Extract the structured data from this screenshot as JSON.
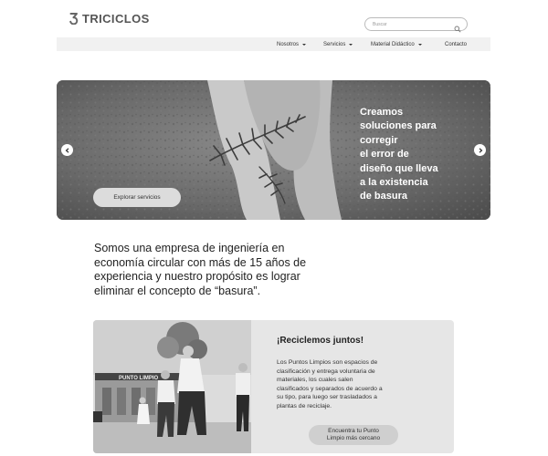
{
  "brand": {
    "name": "TRICICLOS"
  },
  "search": {
    "placeholder": "Buscar"
  },
  "nav": {
    "items": [
      {
        "label": "Nosotros",
        "has_dropdown": true
      },
      {
        "label": "Servicios",
        "has_dropdown": true
      },
      {
        "label": "Material Didáctico",
        "has_dropdown": true
      },
      {
        "label": "Contacto",
        "has_dropdown": false
      }
    ]
  },
  "hero": {
    "lines": [
      "Creamos",
      "soluciones para",
      "corregir",
      "el error de",
      "diseño que lleva",
      "a la existencia",
      "de basura"
    ],
    "button_label": "Explorar servicios"
  },
  "intro": {
    "lines": [
      "Somos una empresa de ingeniería en",
      "economía circular con más de 15 años de",
      "experiencia y nuestro propósito es lograr",
      "eliminar el concepto de “basura”."
    ]
  },
  "card": {
    "title": "¡Reciclemos juntos!",
    "body_lines": [
      "Los Puntos Limpios son espacios de",
      "clasificación y entrega voluntaria de",
      "materiales, los cuales salen",
      "clasificados y separados de acuerdo a",
      "su tipo, para luego ser trasladados a",
      "plantas de reciclaje."
    ],
    "button_lines": [
      "Encuentra tu Punto",
      "Limpio más cercano"
    ],
    "photo_sign": "PUNTO LIMPIO"
  },
  "icons": {
    "logo": "triciclos-logo-icon",
    "search": "search-icon",
    "prev": "chevron-left-icon",
    "next": "chevron-right-icon"
  },
  "colors": {
    "navbar_bg": "#f1f1f1",
    "card_bg": "#e6e6e6",
    "hero_text": "#ffffff"
  }
}
